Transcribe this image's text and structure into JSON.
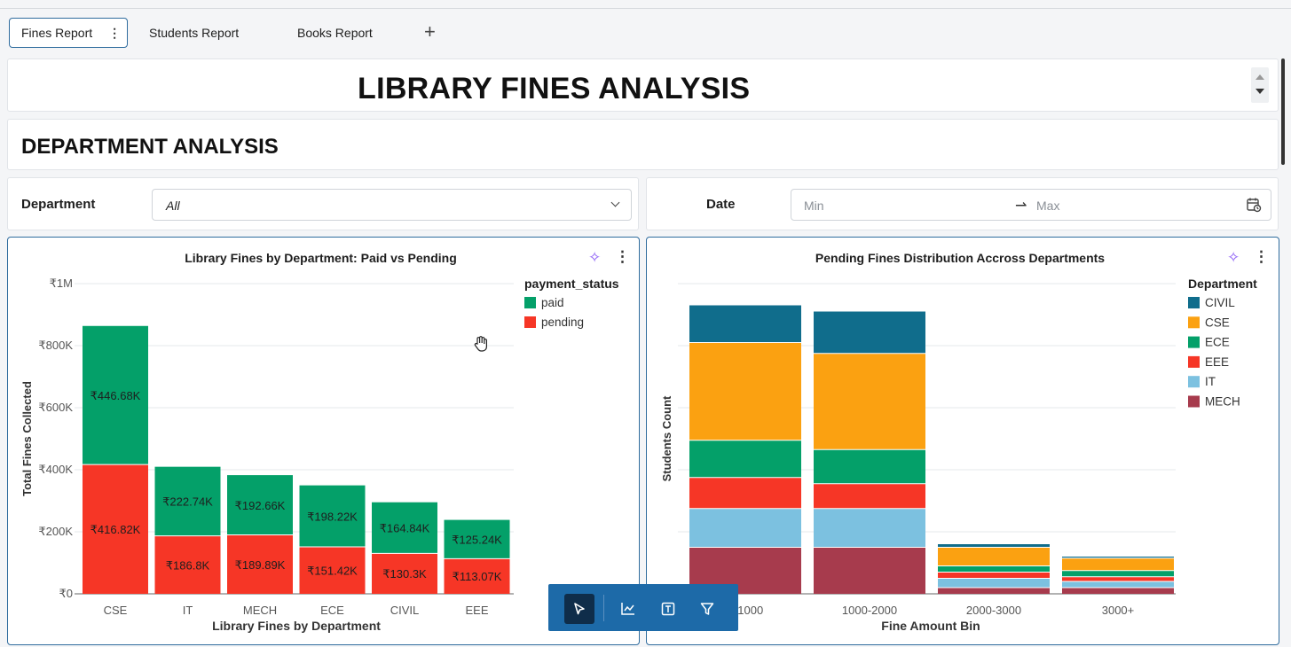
{
  "tabs": {
    "items": [
      {
        "label": "Fines Report",
        "menu": "⋮"
      },
      {
        "label": "Students Report"
      },
      {
        "label": "Books Report"
      }
    ],
    "add_label": "+"
  },
  "header": {
    "title": "LIBRARY FINES ANALYSIS"
  },
  "section": {
    "title": "DEPARTMENT ANALYSIS"
  },
  "filters": {
    "department": {
      "label": "Department",
      "value": "All"
    },
    "date": {
      "label": "Date",
      "min_placeholder": "Min",
      "max_placeholder": "Max",
      "arrow": "⇀"
    }
  },
  "charts": {
    "left": {
      "title": "Library Fines by Department: Paid vs Pending"
    },
    "right": {
      "title": "Pending Fines Distribution Accross Departments"
    }
  },
  "icons": {
    "sparkle": "✧",
    "more": "⋮"
  },
  "colors": {
    "paid": "#04a069",
    "pending": "#f63626",
    "CIVIL": "#106d8c",
    "CSE": "#fba111",
    "ECE": "#04a069",
    "EEE": "#f63626",
    "IT": "#7cc1e0",
    "MECH": "#a73b4d",
    "accent": "#1d6aa8"
  },
  "toolbar": {
    "tools": [
      "cursor-tool",
      "chart-tool",
      "text-tool",
      "filter-tool"
    ]
  },
  "chart_data": [
    {
      "type": "bar",
      "stacked": true,
      "title": "Library Fines by Department: Paid vs Pending",
      "xlabel": "Library Fines by Department",
      "ylabel": "Total Fines Collected",
      "categories": [
        "CSE",
        "IT",
        "MECH",
        "ECE",
        "CIVIL",
        "EEE"
      ],
      "ylim": [
        0,
        1000000
      ],
      "yticks": [
        0,
        200000,
        400000,
        600000,
        800000,
        1000000
      ],
      "ytick_labels": [
        "₹0",
        "₹200K",
        "₹400K",
        "₹600K",
        "₹800K",
        "₹1M"
      ],
      "legend_title": "payment_status",
      "legend_position": "top-right",
      "grid": true,
      "series": [
        {
          "name": "pending",
          "values": [
            416820,
            186800,
            189890,
            151420,
            130300,
            113070
          ],
          "labels": [
            "₹416.82K",
            "₹186.8K",
            "₹189.89K",
            "₹151.42K",
            "₹130.3K",
            "₹113.07K"
          ]
        },
        {
          "name": "paid",
          "values": [
            446680,
            222740,
            192660,
            198220,
            164840,
            125240
          ],
          "labels": [
            "₹446.68K",
            "₹222.74K",
            "₹192.66K",
            "₹198.22K",
            "₹164.84K",
            "₹125.24K"
          ]
        }
      ]
    },
    {
      "type": "bar",
      "stacked": true,
      "title": "Pending Fines Distribution Accross Departments",
      "xlabel": "Fine Amount Bin",
      "ylabel": "Students Count",
      "categories": [
        "0-1000",
        "1000-2000",
        "2000-3000",
        "3000+"
      ],
      "ylim": [
        0,
        100
      ],
      "legend_title": "Department",
      "legend_position": "top-right",
      "grid": true,
      "series": [
        {
          "name": "MECH",
          "values": [
            15,
            15,
            2,
            2
          ]
        },
        {
          "name": "IT",
          "values": [
            12.5,
            12.5,
            3,
            2
          ]
        },
        {
          "name": "EEE",
          "values": [
            10,
            8,
            2,
            1.5
          ]
        },
        {
          "name": "ECE",
          "values": [
            12,
            11,
            2,
            2
          ]
        },
        {
          "name": "CSE",
          "values": [
            31.5,
            31,
            6,
            4
          ]
        },
        {
          "name": "CIVIL",
          "values": [
            12,
            13.5,
            1,
            0.5
          ]
        }
      ]
    }
  ]
}
